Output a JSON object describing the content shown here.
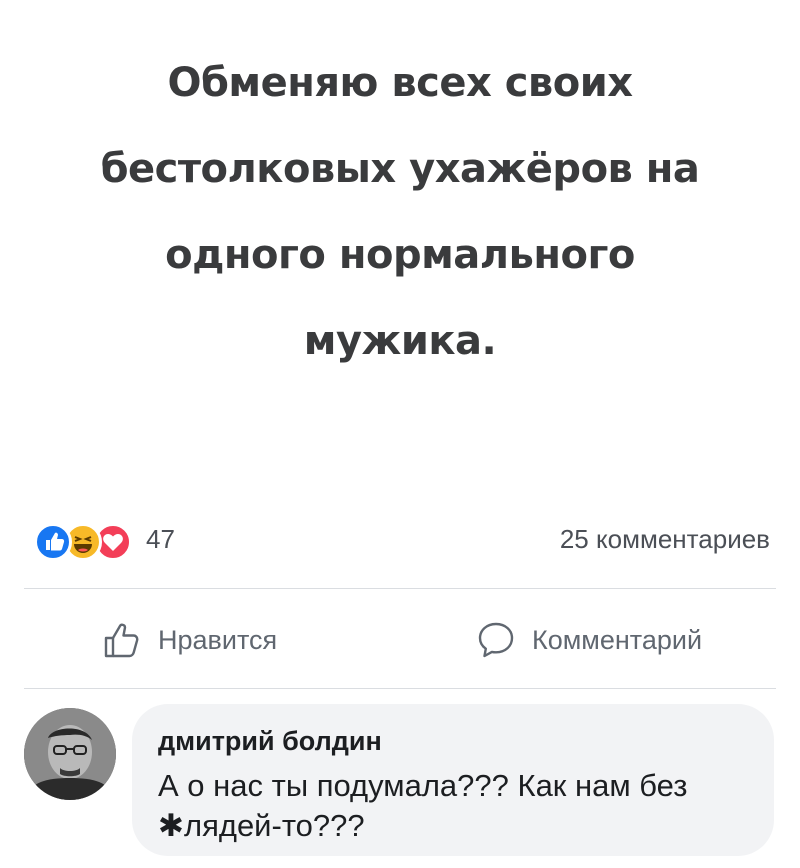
{
  "post": {
    "lines": [
      "Обменяю всех своих",
      "бестолковых ухажёров на",
      "одного нормального",
      "мужика."
    ]
  },
  "reactions": {
    "icons": [
      "like-icon",
      "haha-icon",
      "love-icon"
    ],
    "count": "47",
    "comments_count": "25 комментариев",
    "colors": {
      "like": "#1877f2",
      "haha": "#f7b928",
      "love": "#f33e58"
    }
  },
  "actions": {
    "like_label": "Нравится",
    "comment_label": "Комментарий"
  },
  "comment": {
    "author": "дмитрий болдин",
    "text": "А о нас ты подумала??? Как нам без ✱лядей-то???"
  }
}
